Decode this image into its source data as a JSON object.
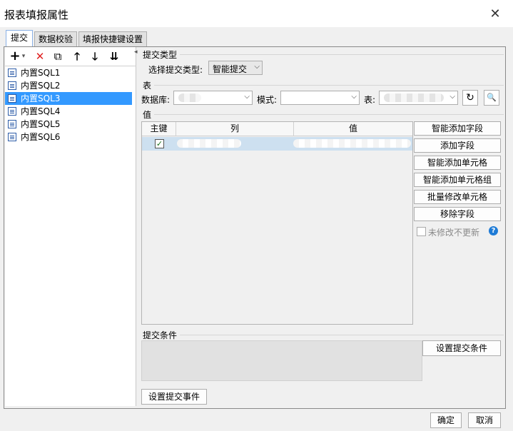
{
  "window": {
    "title": "报表填报属性",
    "close": "✕"
  },
  "tabs": [
    "提交",
    "数据校验",
    "填报快捷键设置"
  ],
  "toolbar": {
    "add": "+",
    "add_arrow": "▾",
    "delete": "✕",
    "copy": "⧉",
    "up": "🡑",
    "down": "🡓",
    "sort": "⇊",
    "collapse": "◂"
  },
  "sql_list": [
    "内置SQL1",
    "内置SQL2",
    "内置SQL3",
    "内置SQL4",
    "内置SQL5",
    "内置SQL6"
  ],
  "submit_type": {
    "section": "提交类型",
    "label": "选择提交类型:",
    "value": "智能提交"
  },
  "table_section": {
    "section": "表",
    "db_label": "数据库:",
    "mode_label": "模式:",
    "table_label": "表:",
    "refresh_icon": "↻",
    "preview_icon": "🔍"
  },
  "values_section": {
    "section": "值",
    "columns": [
      "主键",
      "列",
      "值"
    ],
    "rows": [
      {
        "key_checked": "✓"
      }
    ]
  },
  "side_buttons": [
    "智能添加字段",
    "添加字段",
    "智能添加单元格",
    "智能添加单元格组",
    "批量修改单元格",
    "移除字段"
  ],
  "no_update": {
    "label": "未修改不更新",
    "help": "?"
  },
  "condition": {
    "section": "提交条件",
    "button": "设置提交条件"
  },
  "event_button": "设置提交事件",
  "footer": {
    "ok": "确定",
    "cancel": "取消"
  }
}
